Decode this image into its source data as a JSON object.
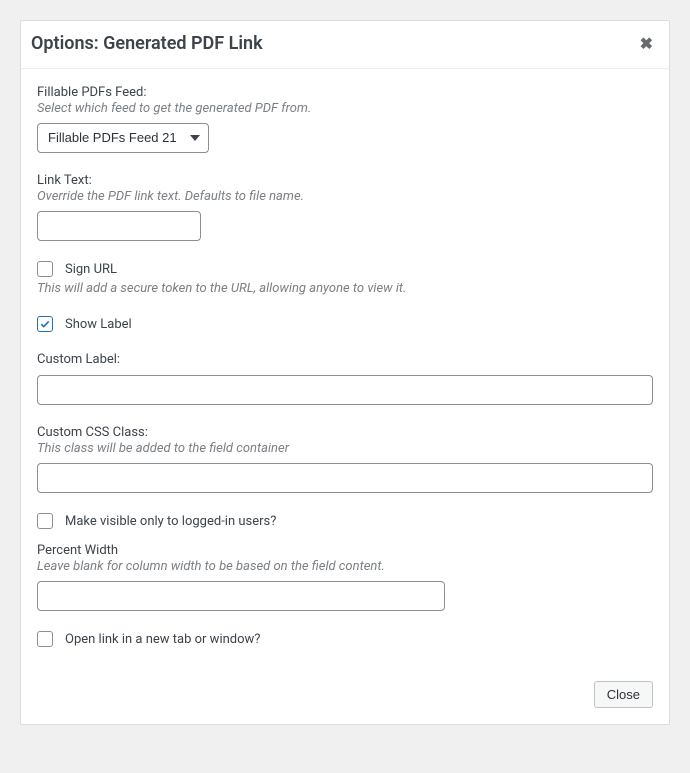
{
  "modal": {
    "title": "Options: Generated PDF Link",
    "close_button_text": "Close"
  },
  "fields": {
    "feed": {
      "label": "Fillable PDFs Feed:",
      "help": "Select which feed to get the generated PDF from.",
      "selected": "Fillable PDFs Feed 21"
    },
    "link_text": {
      "label": "Link Text:",
      "help": "Override the PDF link text. Defaults to file name.",
      "value": ""
    },
    "sign_url": {
      "label": "Sign URL",
      "help": "This will add a secure token to the URL, allowing anyone to view it.",
      "checked": false
    },
    "show_label": {
      "label": "Show Label",
      "checked": true
    },
    "custom_label": {
      "label": "Custom Label:",
      "value": ""
    },
    "custom_css": {
      "label": "Custom CSS Class:",
      "help": "This class will be added to the field container",
      "value": ""
    },
    "logged_in": {
      "label": "Make visible only to logged-in users?",
      "checked": false
    },
    "percent_width": {
      "label": "Percent Width",
      "help": "Leave blank for column width to be based on the field content.",
      "value": ""
    },
    "new_tab": {
      "label": "Open link in a new tab or window?",
      "checked": false
    }
  }
}
